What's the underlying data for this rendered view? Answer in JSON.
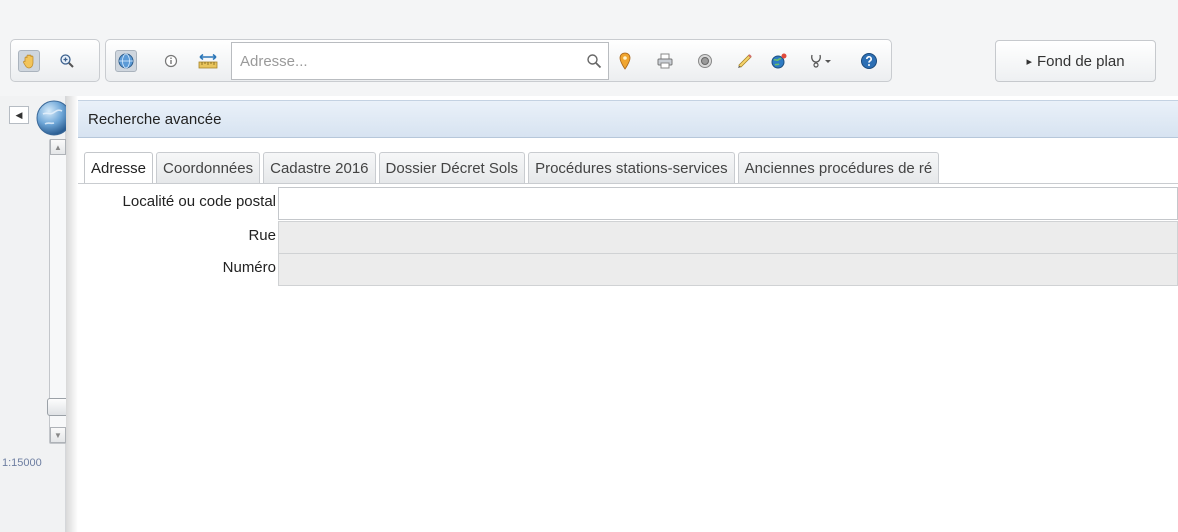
{
  "toolbar": {
    "search": {
      "value": "",
      "placeholder": "Adresse..."
    },
    "fond_de_plan": {
      "arrow": "▸",
      "label": "Fond de plan"
    }
  },
  "map": {
    "scale": "1:15000"
  },
  "panel": {
    "title": "Recherche avancée",
    "tabs": [
      {
        "label": "Adresse"
      },
      {
        "label": "Coordonnées"
      },
      {
        "label": "Cadastre 2016"
      },
      {
        "label": "Dossier Décret Sols"
      },
      {
        "label": "Procédures stations-services"
      },
      {
        "label": "Anciennes procédures de ré"
      }
    ],
    "fields": {
      "localite": {
        "label": "Localité ou code postal",
        "value": ""
      },
      "rue": {
        "label": "Rue",
        "value": ""
      },
      "numero": {
        "label": "Numéro",
        "value": ""
      }
    }
  }
}
